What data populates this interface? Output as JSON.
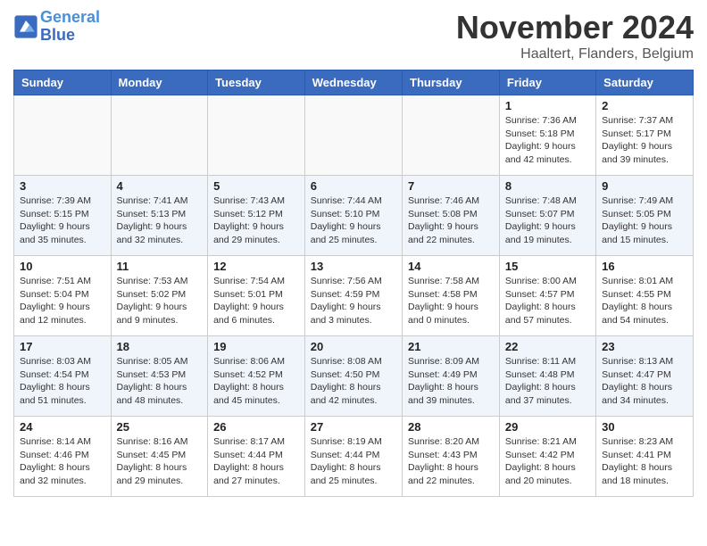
{
  "header": {
    "logo_line1": "General",
    "logo_line2": "Blue",
    "month_title": "November 2024",
    "location": "Haaltert, Flanders, Belgium"
  },
  "days_of_week": [
    "Sunday",
    "Monday",
    "Tuesday",
    "Wednesday",
    "Thursday",
    "Friday",
    "Saturday"
  ],
  "weeks": [
    [
      {
        "day": "",
        "info": ""
      },
      {
        "day": "",
        "info": ""
      },
      {
        "day": "",
        "info": ""
      },
      {
        "day": "",
        "info": ""
      },
      {
        "day": "",
        "info": ""
      },
      {
        "day": "1",
        "info": "Sunrise: 7:36 AM\nSunset: 5:18 PM\nDaylight: 9 hours and 42 minutes."
      },
      {
        "day": "2",
        "info": "Sunrise: 7:37 AM\nSunset: 5:17 PM\nDaylight: 9 hours and 39 minutes."
      }
    ],
    [
      {
        "day": "3",
        "info": "Sunrise: 7:39 AM\nSunset: 5:15 PM\nDaylight: 9 hours and 35 minutes."
      },
      {
        "day": "4",
        "info": "Sunrise: 7:41 AM\nSunset: 5:13 PM\nDaylight: 9 hours and 32 minutes."
      },
      {
        "day": "5",
        "info": "Sunrise: 7:43 AM\nSunset: 5:12 PM\nDaylight: 9 hours and 29 minutes."
      },
      {
        "day": "6",
        "info": "Sunrise: 7:44 AM\nSunset: 5:10 PM\nDaylight: 9 hours and 25 minutes."
      },
      {
        "day": "7",
        "info": "Sunrise: 7:46 AM\nSunset: 5:08 PM\nDaylight: 9 hours and 22 minutes."
      },
      {
        "day": "8",
        "info": "Sunrise: 7:48 AM\nSunset: 5:07 PM\nDaylight: 9 hours and 19 minutes."
      },
      {
        "day": "9",
        "info": "Sunrise: 7:49 AM\nSunset: 5:05 PM\nDaylight: 9 hours and 15 minutes."
      }
    ],
    [
      {
        "day": "10",
        "info": "Sunrise: 7:51 AM\nSunset: 5:04 PM\nDaylight: 9 hours and 12 minutes."
      },
      {
        "day": "11",
        "info": "Sunrise: 7:53 AM\nSunset: 5:02 PM\nDaylight: 9 hours and 9 minutes."
      },
      {
        "day": "12",
        "info": "Sunrise: 7:54 AM\nSunset: 5:01 PM\nDaylight: 9 hours and 6 minutes."
      },
      {
        "day": "13",
        "info": "Sunrise: 7:56 AM\nSunset: 4:59 PM\nDaylight: 9 hours and 3 minutes."
      },
      {
        "day": "14",
        "info": "Sunrise: 7:58 AM\nSunset: 4:58 PM\nDaylight: 9 hours and 0 minutes."
      },
      {
        "day": "15",
        "info": "Sunrise: 8:00 AM\nSunset: 4:57 PM\nDaylight: 8 hours and 57 minutes."
      },
      {
        "day": "16",
        "info": "Sunrise: 8:01 AM\nSunset: 4:55 PM\nDaylight: 8 hours and 54 minutes."
      }
    ],
    [
      {
        "day": "17",
        "info": "Sunrise: 8:03 AM\nSunset: 4:54 PM\nDaylight: 8 hours and 51 minutes."
      },
      {
        "day": "18",
        "info": "Sunrise: 8:05 AM\nSunset: 4:53 PM\nDaylight: 8 hours and 48 minutes."
      },
      {
        "day": "19",
        "info": "Sunrise: 8:06 AM\nSunset: 4:52 PM\nDaylight: 8 hours and 45 minutes."
      },
      {
        "day": "20",
        "info": "Sunrise: 8:08 AM\nSunset: 4:50 PM\nDaylight: 8 hours and 42 minutes."
      },
      {
        "day": "21",
        "info": "Sunrise: 8:09 AM\nSunset: 4:49 PM\nDaylight: 8 hours and 39 minutes."
      },
      {
        "day": "22",
        "info": "Sunrise: 8:11 AM\nSunset: 4:48 PM\nDaylight: 8 hours and 37 minutes."
      },
      {
        "day": "23",
        "info": "Sunrise: 8:13 AM\nSunset: 4:47 PM\nDaylight: 8 hours and 34 minutes."
      }
    ],
    [
      {
        "day": "24",
        "info": "Sunrise: 8:14 AM\nSunset: 4:46 PM\nDaylight: 8 hours and 32 minutes."
      },
      {
        "day": "25",
        "info": "Sunrise: 8:16 AM\nSunset: 4:45 PM\nDaylight: 8 hours and 29 minutes."
      },
      {
        "day": "26",
        "info": "Sunrise: 8:17 AM\nSunset: 4:44 PM\nDaylight: 8 hours and 27 minutes."
      },
      {
        "day": "27",
        "info": "Sunrise: 8:19 AM\nSunset: 4:44 PM\nDaylight: 8 hours and 25 minutes."
      },
      {
        "day": "28",
        "info": "Sunrise: 8:20 AM\nSunset: 4:43 PM\nDaylight: 8 hours and 22 minutes."
      },
      {
        "day": "29",
        "info": "Sunrise: 8:21 AM\nSunset: 4:42 PM\nDaylight: 8 hours and 20 minutes."
      },
      {
        "day": "30",
        "info": "Sunrise: 8:23 AM\nSunset: 4:41 PM\nDaylight: 8 hours and 18 minutes."
      }
    ]
  ]
}
